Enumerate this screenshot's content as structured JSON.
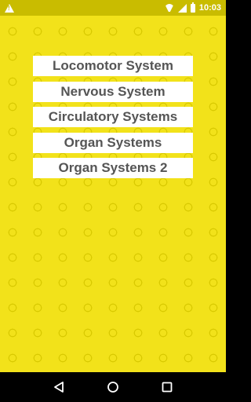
{
  "status_bar": {
    "time": "10:03",
    "icons": [
      "warning-icon",
      "wifi-icon",
      "signal-icon",
      "battery-icon"
    ],
    "background": "#c9bc00"
  },
  "menu": {
    "items": [
      {
        "label": "Locomotor System"
      },
      {
        "label": "Nervous System"
      },
      {
        "label": "Circulatory Systems"
      },
      {
        "label": "Organ Systems"
      },
      {
        "label": "Organ Systems 2"
      }
    ]
  },
  "nav_bar": {
    "icons": [
      "back-icon",
      "home-icon",
      "recents-icon"
    ]
  },
  "colors": {
    "background": "#f2e21a",
    "pattern": "#d8c900",
    "button_bg": "#ffffff",
    "button_text": "#555555"
  }
}
